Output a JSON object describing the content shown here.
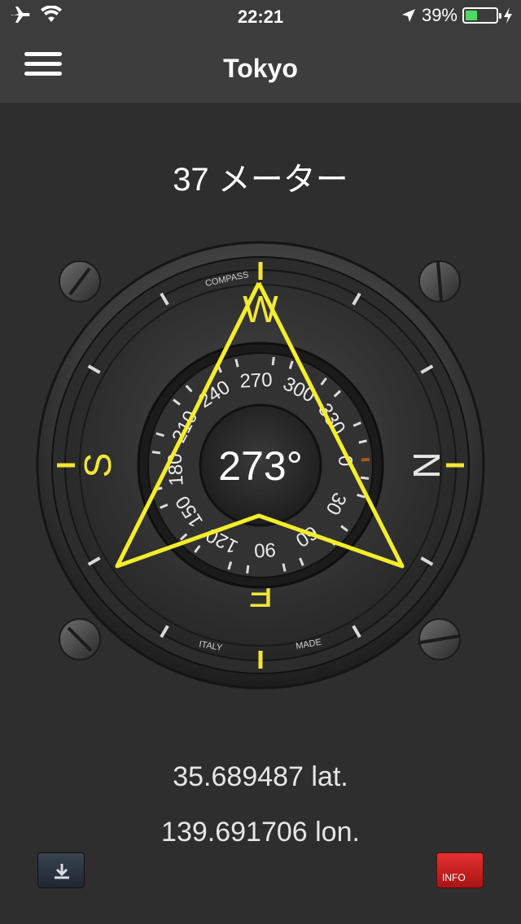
{
  "status_bar": {
    "time": "22:21",
    "battery_percent": "39%",
    "battery_level": 0.39,
    "icons": [
      "airplane-icon",
      "wifi-icon",
      "location-arrow-icon",
      "battery-icon",
      "charging-icon"
    ]
  },
  "nav": {
    "title": "Tokyo",
    "menu_icon": "hamburger-menu-icon"
  },
  "altitude": {
    "value": "37 メーター"
  },
  "compass": {
    "heading_text": "273°",
    "heading_deg": 273,
    "bezel_labels": {
      "top": "COMPASS",
      "bottom_left": "ITALY",
      "bottom_right": "MADE"
    },
    "cardinals": {
      "top": "W",
      "right": "N",
      "bottom": "E",
      "left": "S"
    },
    "dial_numbers": [
      "0",
      "30",
      "60",
      "90",
      "120",
      "150",
      "180",
      "210",
      "240",
      "270",
      "300",
      "330"
    ],
    "accent_color": "#f2e634",
    "needle_color": "#f4ee2a"
  },
  "coordinates": {
    "lat": "35.689487 lat.",
    "lon": "139.691706 lon."
  },
  "buttons": {
    "download_icon": "download-icon",
    "info_label": "INFO"
  }
}
